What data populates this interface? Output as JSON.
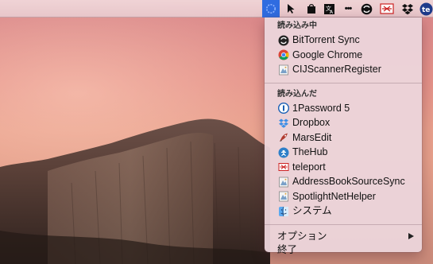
{
  "menubar": {
    "icons": [
      {
        "name": "teleport-menubar-icon",
        "active": true
      },
      {
        "name": "cursor-icon"
      },
      {
        "name": "shopping-bag-icon"
      },
      {
        "name": "translate-icon"
      },
      {
        "name": "more-dots-icon",
        "text": "•••"
      },
      {
        "name": "bittorrent-sync-icon"
      },
      {
        "name": "teleport-status-icon"
      },
      {
        "name": "dropbox-icon"
      },
      {
        "name": "app-icon",
        "text": "te"
      }
    ]
  },
  "menu": {
    "sections": [
      {
        "header": "読み込み中",
        "items": [
          {
            "label": "BitTorrent Sync",
            "icon": "bittorrent-sync-icon"
          },
          {
            "label": "Google Chrome",
            "icon": "chrome-icon"
          },
          {
            "label": "CIJScannerRegister",
            "icon": "generic-app-icon"
          }
        ]
      },
      {
        "header": "読み込んだ",
        "items": [
          {
            "label": "1Password 5",
            "icon": "onepassword-icon"
          },
          {
            "label": "Dropbox",
            "icon": "dropbox-icon"
          },
          {
            "label": "MarsEdit",
            "icon": "marsedit-icon"
          },
          {
            "label": "TheHub",
            "icon": "thehub-icon"
          },
          {
            "label": "teleport",
            "icon": "teleport-icon"
          },
          {
            "label": "AddressBookSourceSync",
            "icon": "generic-app-icon"
          },
          {
            "label": "SpotlightNetHelper",
            "icon": "generic-app-icon"
          },
          {
            "label": "システム",
            "icon": "finder-icon"
          }
        ]
      }
    ],
    "options_label": "オプション",
    "quit_label": "終了"
  },
  "colors": {
    "menubar_active": "#2f6ce0",
    "menu_background": "#ecd6dc",
    "sky_top": "#d8868a",
    "sky_bottom": "#e8a08c"
  }
}
